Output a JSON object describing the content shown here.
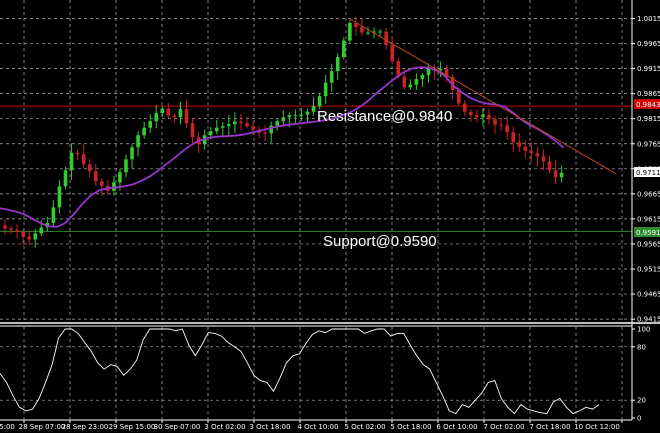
{
  "chart_data": [
    {
      "type": "candlestick",
      "title": "",
      "y_axis": {
        "ticks": [
          "1.0015",
          "0.9965",
          "0.9915",
          "0.9865",
          "0.9815",
          "0.9765",
          "0.9715",
          "0.9665",
          "0.9615",
          "0.9565",
          "0.9515",
          "0.9465",
          "0.9415"
        ],
        "ylim": [
          0.94,
          1.003
        ]
      },
      "x_axis": {
        "ticks": [
          "5:00",
          "28 Sep 07:00",
          "28 Sep 23:00",
          "29 Sep 15:00",
          "30 Sep 07:00",
          "3 Oct 02:00",
          "3 Oct 18:00",
          "4 Oct 10:00",
          "5 Oct 02:00",
          "5 Oct 18:00",
          "6 Oct 10:00",
          "7 Oct 02:00",
          "7 Oct 18:00",
          "10 Oct 12:00"
        ]
      },
      "grid": true,
      "close_series": [
        0.9596,
        0.9593,
        0.9589,
        0.958,
        0.9574,
        0.9586,
        0.9598,
        0.9607,
        0.9638,
        0.968,
        0.9712,
        0.9747,
        0.9744,
        0.9724,
        0.971,
        0.969,
        0.9681,
        0.9671,
        0.9688,
        0.9708,
        0.9734,
        0.9758,
        0.9782,
        0.9797,
        0.981,
        0.9826,
        0.9835,
        0.9821,
        0.9818,
        0.9834,
        0.9806,
        0.9778,
        0.9764,
        0.9782,
        0.979,
        0.9797,
        0.98,
        0.9804,
        0.9809,
        0.9806,
        0.98,
        0.9793,
        0.9787,
        0.9786,
        0.9801,
        0.981,
        0.9818,
        0.9822,
        0.9822,
        0.9823,
        0.9829,
        0.984,
        0.986,
        0.9887,
        0.991,
        0.9938,
        0.9971,
        1.0006,
        0.9998,
        0.9987,
        0.9987,
        0.9989,
        0.9989,
        0.9962,
        0.993,
        0.9899,
        0.9878,
        0.9883,
        0.9894,
        0.9902,
        0.9914,
        0.9912,
        0.9914,
        0.9898,
        0.9872,
        0.9845,
        0.9829,
        0.9822,
        0.9818,
        0.9823,
        0.9814,
        0.9803,
        0.9802,
        0.9788,
        0.9768,
        0.9759,
        0.9751,
        0.9746,
        0.974,
        0.973,
        0.9712,
        0.9698,
        0.9707
      ],
      "moving_average": [
        0.9637,
        0.9634,
        0.963,
        0.9625,
        0.9616,
        0.9607,
        0.96,
        0.9599,
        0.9607,
        0.9625,
        0.9645,
        0.9662,
        0.9672,
        0.9676,
        0.9678,
        0.968,
        0.9684,
        0.9691,
        0.97,
        0.9712,
        0.9725,
        0.9738,
        0.9752,
        0.9764,
        0.9772,
        0.9777,
        0.9779,
        0.978,
        0.9781,
        0.9783,
        0.9787,
        0.9791,
        0.9795,
        0.9799,
        0.9802,
        0.9804,
        0.9806,
        0.9808,
        0.981,
        0.9813,
        0.9817,
        0.9823,
        0.983,
        0.984,
        0.9853,
        0.9868,
        0.9882,
        0.9895,
        0.9907,
        0.9915,
        0.9918,
        0.9917,
        0.9911,
        0.9899,
        0.988,
        0.9867,
        0.9856,
        0.9849,
        0.9845,
        0.9843,
        0.9839,
        0.9827,
        0.9813,
        0.9802,
        0.9794,
        0.9783,
        0.9771,
        0.9757
      ],
      "levels": {
        "resistance": {
          "value": 0.984,
          "tag": "0.9843",
          "color": "#cc0000"
        },
        "support": {
          "value": 0.959,
          "tag": "0.9591",
          "color": "#2e8b2e"
        },
        "current_price_tag": "0.9711"
      },
      "trendline": {
        "from": {
          "bar": 57,
          "value": 1.0014
        },
        "to": {
          "bar": 101,
          "value": 0.9705
        },
        "color": "#b8481f"
      },
      "annotations": [
        "Resistance@0.9840",
        "Support@0.9590"
      ],
      "colors": {
        "bull": "#33cc33",
        "bear": "#cc2222",
        "ma": "#9933cc",
        "grid": "#b0b0b0",
        "oscillator": "#ffffff"
      }
    },
    {
      "type": "line",
      "title": "",
      "y_axis": {
        "ticks": [
          "100",
          "80",
          "20",
          "0"
        ],
        "ylim": [
          0,
          100
        ]
      },
      "grid": true,
      "values": [
        50,
        40,
        25,
        12,
        8,
        10,
        22,
        40,
        60,
        90,
        100,
        100,
        95,
        85,
        75,
        62,
        55,
        60,
        58,
        48,
        55,
        65,
        88,
        100,
        100,
        100,
        100,
        98,
        100,
        82,
        70,
        82,
        96,
        95,
        92,
        85,
        80,
        75,
        62,
        48,
        42,
        40,
        30,
        45,
        62,
        70,
        72,
        84,
        94,
        98,
        96,
        100,
        100,
        100,
        100,
        100,
        95,
        98,
        100,
        100,
        92,
        95,
        95,
        82,
        70,
        60,
        55,
        40,
        25,
        8,
        5,
        15,
        12,
        20,
        28,
        40,
        42,
        22,
        12,
        5,
        15,
        10,
        8,
        6,
        5,
        18,
        22,
        12,
        5,
        8,
        12,
        10,
        15
      ]
    }
  ]
}
